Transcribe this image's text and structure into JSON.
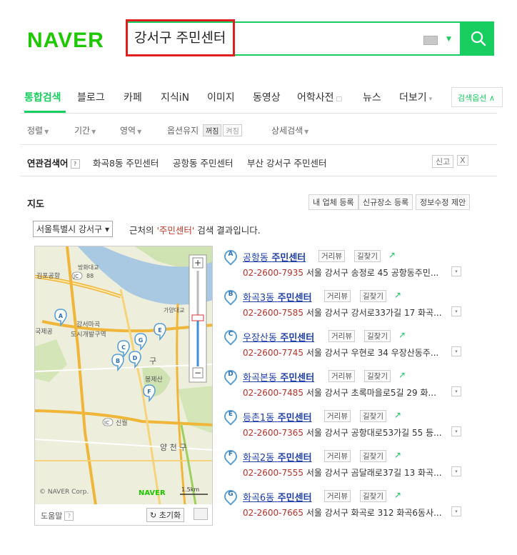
{
  "header": {
    "logo": "NAVER",
    "query": "강서구 주민센터"
  },
  "colors": {
    "brand": "#19ce60",
    "highlight": "#e01e1e",
    "link": "#1f3fa8",
    "tel": "#b8332a"
  },
  "tabs": [
    {
      "label": "통합검색",
      "active": true
    },
    {
      "label": "블로그"
    },
    {
      "label": "카페"
    },
    {
      "label": "지식iN"
    },
    {
      "label": "이미지"
    },
    {
      "label": "동영상"
    },
    {
      "label": "어학사전",
      "mini": "□"
    },
    {
      "label": "뉴스"
    },
    {
      "label": "더보기",
      "mini": "▾"
    }
  ],
  "tab_options_label": "검색옵션 ∧",
  "filters": {
    "sort": "정렬",
    "period": "기간",
    "area": "영역",
    "keep_option": "옵션유지",
    "toggle_off": "꺼짐",
    "toggle_on": "켜짐",
    "detail": "상세검색"
  },
  "related": {
    "title": "연관검색어",
    "help": "?",
    "items": [
      "화곡8동 주민센터",
      "공항동 주민센터",
      "부산 강서구 주민센터"
    ],
    "report": "신고",
    "close": "X"
  },
  "map": {
    "title": "지도",
    "buttons": [
      "내 업체 등록",
      "신규장소 등록",
      "정보수정 제안"
    ],
    "region": "서울특별시 강서구 ▾",
    "result_prefix": "근처의 ",
    "result_keyword": "'주민센터'",
    "result_suffix": " 검색 결과입니다.",
    "copyright": "© NAVER Corp.",
    "watermark": "NAVER",
    "scale": "1.5km",
    "zoom_in": "+",
    "zoom_out": "−",
    "help": "도움말",
    "help_q": "?",
    "reset": "↻ 초기화",
    "labels": {
      "l1": "방화대교",
      "l2": "김포공항",
      "l3": "88",
      "l4": "강서마곡",
      "l5": "도시개발구역",
      "l6": "국제공",
      "l7": "가양대교",
      "l8": "봉제산",
      "l9": "신월",
      "l10": "양 천 구",
      "l11": "구",
      "l12": "JC",
      "l13": "IC"
    },
    "pins": [
      "A",
      "B",
      "C",
      "D",
      "E",
      "F",
      "G"
    ]
  },
  "results": [
    {
      "letter": "A",
      "area": "공항동",
      "kw": "주민센터",
      "tel": "02-2600-7935",
      "addr": "서울 강서구 송정로 45 공항동주민..."
    },
    {
      "letter": "B",
      "area": "화곡3동",
      "kw": "주민센터",
      "tel": "02-2600-7585",
      "addr": "서울 강서구 강서로33가길 17 화곡..."
    },
    {
      "letter": "C",
      "area": "우장산동",
      "kw": "주민센터",
      "tel": "02-2600-7745",
      "addr": "서울 강서구 우현로 34 우장산동주..."
    },
    {
      "letter": "D",
      "area": "화곡본동",
      "kw": "주민센터",
      "tel": "02-2600-7485",
      "addr": "서울 강서구 초록마을로5길 29 화..."
    },
    {
      "letter": "E",
      "area": "등촌1동",
      "kw": "주민센터",
      "tel": "02-2600-7365",
      "addr": "서울 강서구 공항대로53가길 55 등..."
    },
    {
      "letter": "F",
      "area": "화곡2동",
      "kw": "주민센터",
      "tel": "02-2600-7555",
      "addr": "서울 강서구 곰달래로37길 13 화곡..."
    },
    {
      "letter": "G",
      "area": "화곡6동",
      "kw": "주민센터",
      "tel": "02-2600-7665",
      "addr": "서울 강서구 화곡로 312 화곡6동사..."
    }
  ],
  "result_chips": {
    "street": "거리뷰",
    "route": "길찾기",
    "more": "▾"
  }
}
